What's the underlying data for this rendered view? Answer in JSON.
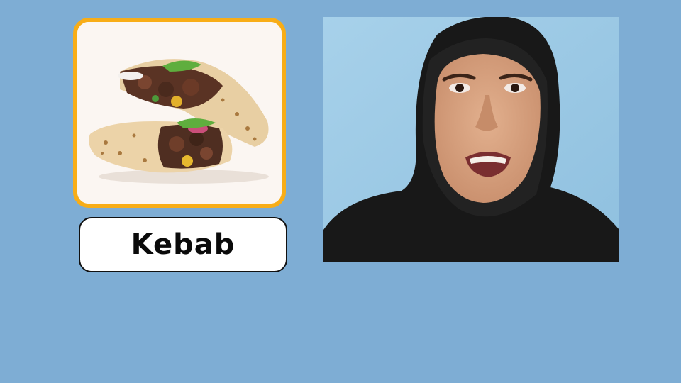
{
  "colors": {
    "background": "#7eadd4",
    "card_border": "#f8ad17",
    "card_fill": "#fbf6f2",
    "video_backdrop": "#9cc8e4"
  },
  "food_card": {
    "image": "kebab-wrap-image"
  },
  "label": {
    "text": "Kebab"
  },
  "video": {
    "image": "presenter-video-frame"
  }
}
